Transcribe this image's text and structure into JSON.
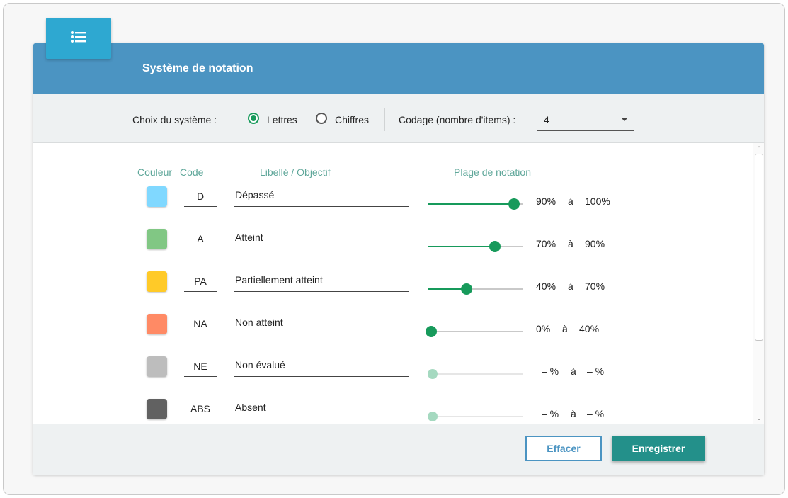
{
  "header": {
    "title": "Système de notation",
    "badge_icon": "list-icon"
  },
  "options": {
    "system_label": "Choix du système :",
    "radio_letters": "Lettres",
    "radio_digits": "Chiffres",
    "selected_system": "Lettres",
    "coding_label": "Codage (nombre d'items) :",
    "coding_value": "4"
  },
  "columns": {
    "color": "Couleur",
    "code": "Code",
    "label": "Libellé / Objectif",
    "range": "Plage de notation"
  },
  "rows": [
    {
      "color": "#80d8ff",
      "code": "D",
      "label": "Dépassé",
      "from": "90%",
      "a": "à",
      "to": "100%",
      "slider": 0.9,
      "enabled": true
    },
    {
      "color": "#81c784",
      "code": "A",
      "label": "Atteint",
      "from": "70%",
      "a": "à",
      "to": "90%",
      "slider": 0.7,
      "enabled": true
    },
    {
      "color": "#ffca28",
      "code": "PA",
      "label": "Partiellement atteint",
      "from": "40%",
      "a": "à",
      "to": "70%",
      "slider": 0.4,
      "enabled": true
    },
    {
      "color": "#ff8a65",
      "code": "NA",
      "label": "Non atteint",
      "from": "0%",
      "a": "à",
      "to": "40%",
      "slider": 0.0,
      "enabled": true
    },
    {
      "color": "#bdbdbd",
      "code": "NE",
      "label": "Non évalué",
      "from": "– %",
      "a": "à",
      "to": "– %",
      "slider": 0.0,
      "enabled": false
    },
    {
      "color": "#616161",
      "code": "ABS",
      "label": "Absent",
      "from": "– %",
      "a": "à",
      "to": "– %",
      "slider": 0.0,
      "enabled": false
    }
  ],
  "footer": {
    "clear_label": "Effacer",
    "save_label": "Enregistrer"
  },
  "colors": {
    "header": "#4b94c2",
    "badge": "#2ea8d1",
    "accent_green": "#179a5b",
    "save_button": "#23908a",
    "column_heading": "#5fa79a"
  }
}
